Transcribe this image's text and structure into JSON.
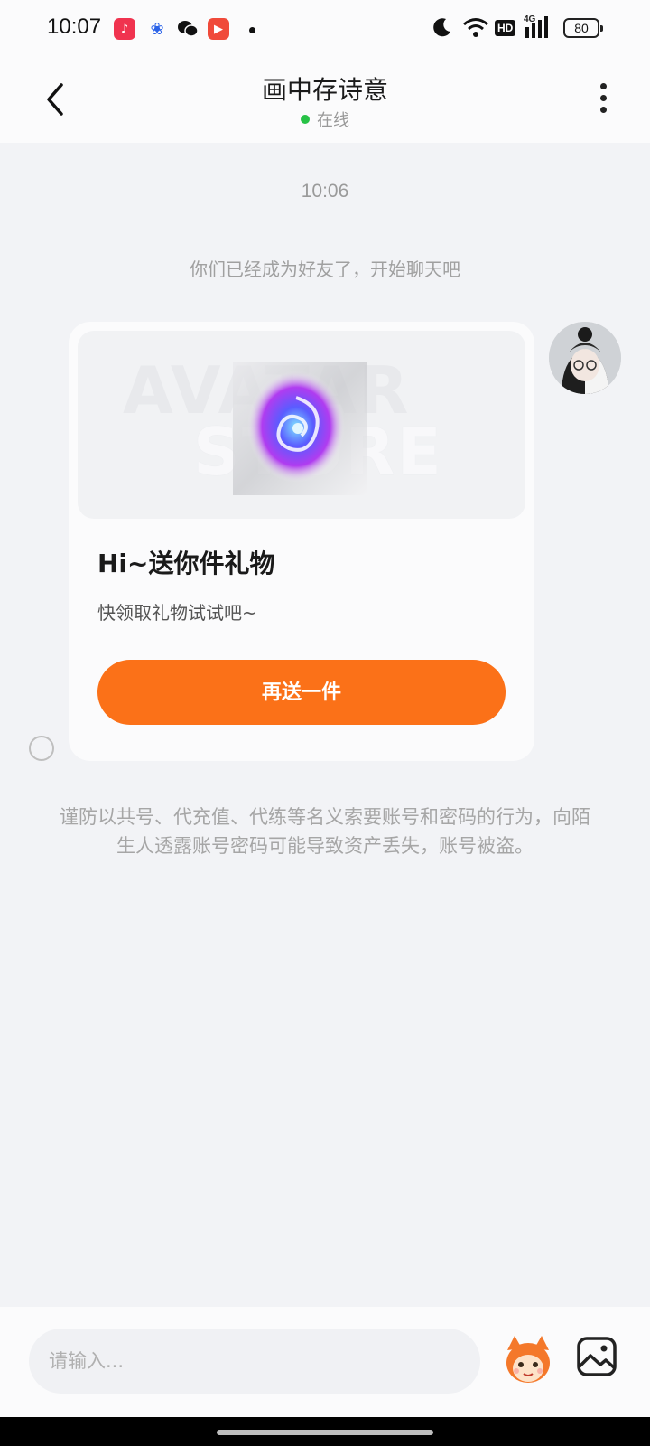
{
  "status_bar": {
    "time": "10:07",
    "battery": "80",
    "network": "4G",
    "hd_label": "HD",
    "notification_icons": [
      "music-app-icon",
      "baidu-app-icon",
      "wechat-icon",
      "video-app-icon"
    ]
  },
  "header": {
    "title": "画中存诗意",
    "status": "在线",
    "status_color": "#27c246"
  },
  "chat": {
    "timestamp": "10:06",
    "system_message": "你们已经成为好友了，开始聊天吧",
    "gift_card": {
      "watermark_line1": "AVATAR",
      "watermark_line2": "STORE",
      "title": "Hi~送你件礼物",
      "subtitle": "快领取礼物试试吧~",
      "button_label": "再送一件",
      "button_color": "#fb7118"
    },
    "warning": "谨防以共号、代充值、代练等名义索要账号和密码的行为，向陌生人透露账号密码可能导致资产丢失，账号被盗。"
  },
  "input_bar": {
    "placeholder": "请输入..."
  }
}
